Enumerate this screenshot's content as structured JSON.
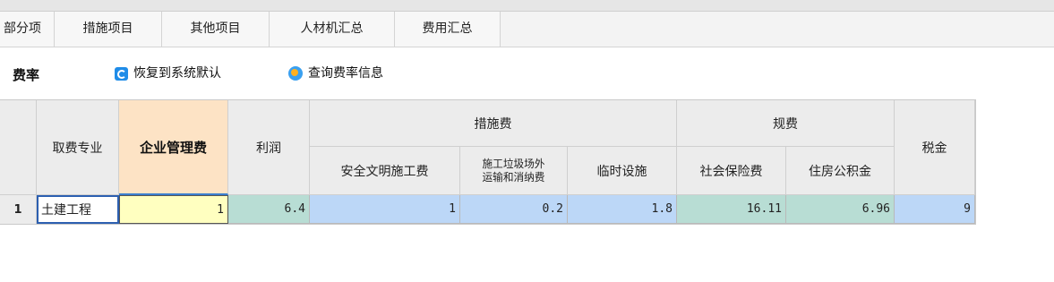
{
  "tabs": [
    {
      "label": "部分项"
    },
    {
      "label": "措施项目"
    },
    {
      "label": "其他项目"
    },
    {
      "label": "人材机汇总"
    },
    {
      "label": "费用汇总"
    }
  ],
  "toolbar": {
    "title": "费率",
    "restore_label": "恢复到系统默认",
    "query_label": "查询费率信息"
  },
  "table": {
    "headers": {
      "specialty": "取费专业",
      "management_fee": "企业管理费",
      "profit": "利润",
      "measures_group": "措施费",
      "safety": "安全文明施工费",
      "garbage": "施工垃圾场外运输和消纳费",
      "garbage_line1": "施工垃圾场外",
      "garbage_line2": "运输和消纳费",
      "temporary": "临时设施",
      "regulation_group": "规费",
      "social_insurance": "社会保险费",
      "housing_fund": "住房公积金",
      "tax": "税金"
    },
    "rows": [
      {
        "index": "1",
        "specialty": "土建工程",
        "management_fee": "1",
        "profit": "6.4",
        "safety": "1",
        "garbage": "0.2",
        "temporary": "1.8",
        "social_insurance": "16.11",
        "housing_fund": "6.96",
        "tax": "9"
      }
    ]
  },
  "colors": {
    "highlight_header": "#fde3c5",
    "input_yellow": "#ffffc0",
    "green_cell": "#b8ddd4",
    "blue_cell": "#bcd7f7",
    "selection_border": "#2c5fb0"
  }
}
